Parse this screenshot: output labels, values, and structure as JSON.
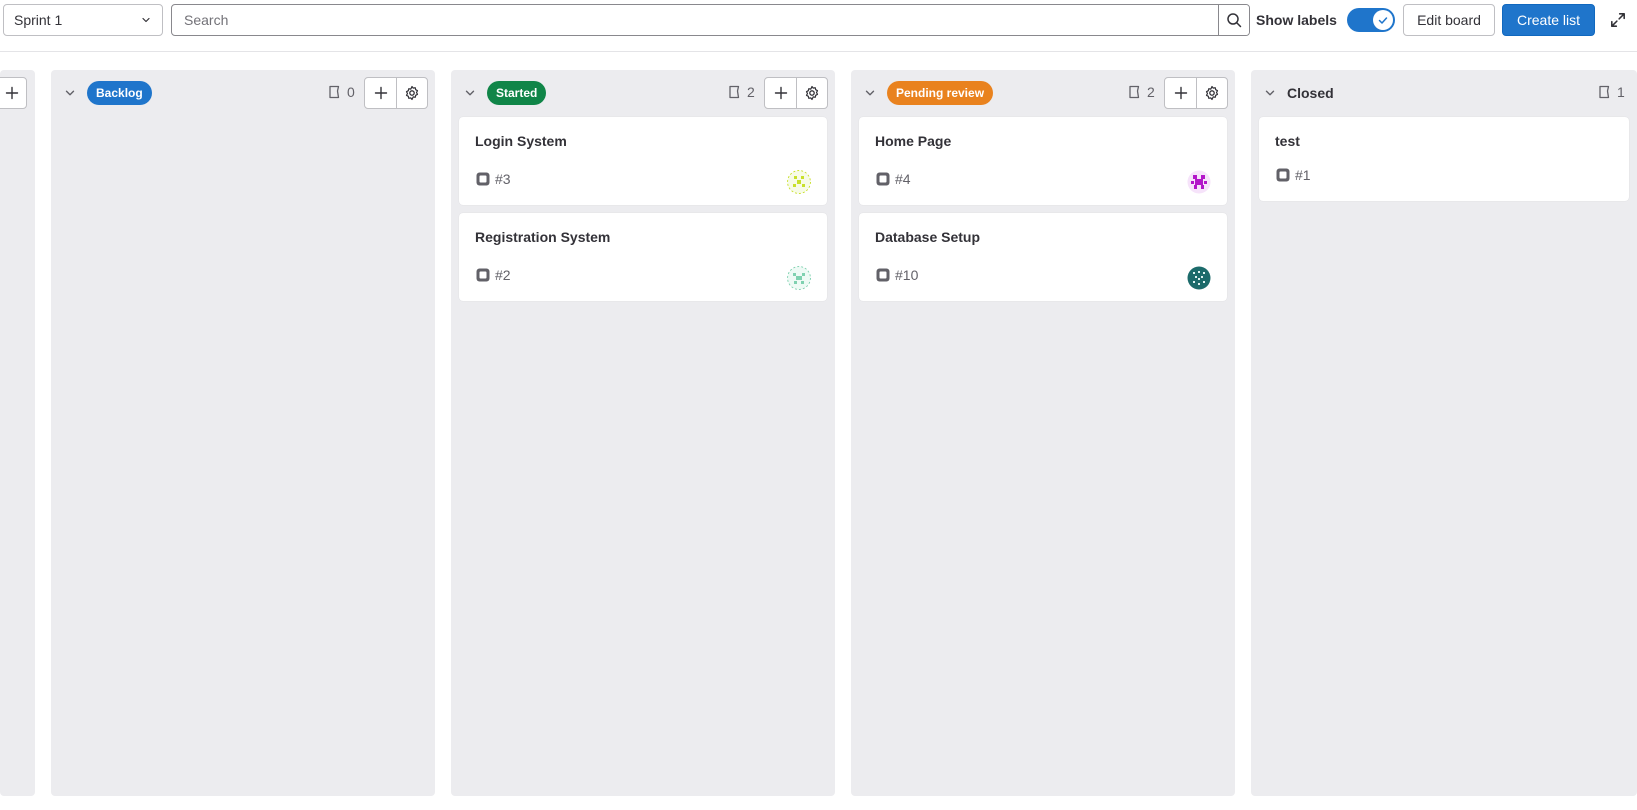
{
  "toolbar": {
    "iteration_select": "Sprint 1",
    "search_placeholder": "Search",
    "show_labels": "Show labels",
    "show_labels_on": true,
    "edit_board": "Edit board",
    "create_list": "Create list"
  },
  "colors": {
    "primary": "#1f75cb",
    "backlog": "#1f75cb",
    "started": "#108548",
    "pending_review": "#e9821e",
    "column_bg": "#ececef"
  },
  "lists": [
    {
      "label": "Backlog",
      "count": "0",
      "cards": []
    },
    {
      "label": "Started",
      "count": "2",
      "cards": [
        {
          "title": "Login System",
          "ref": "#3",
          "avatar_color": "#c8e02a"
        },
        {
          "title": "Registration System",
          "ref": "#2",
          "avatar_color": "#7fd1b0"
        }
      ]
    },
    {
      "label": "Pending review",
      "count": "2",
      "cards": [
        {
          "title": "Home Page",
          "ref": "#4",
          "avatar_color": "#b316c9"
        },
        {
          "title": "Database Setup",
          "ref": "#10",
          "avatar_color": "#1c6b6b"
        }
      ]
    },
    {
      "label": "Closed",
      "count": "1",
      "cards": [
        {
          "title": "test",
          "ref": "#1"
        }
      ]
    }
  ]
}
